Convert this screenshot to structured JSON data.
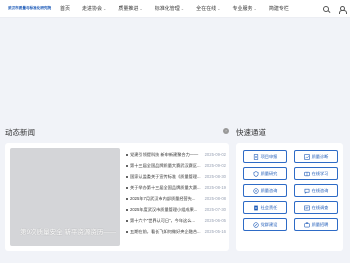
{
  "header": {
    "logo_text": "武汉市质量与标准化研究院",
    "nav": [
      {
        "label": "首页",
        "has_dropdown": false
      },
      {
        "label": "走进协会",
        "has_dropdown": true
      },
      {
        "label": "质量推进",
        "has_dropdown": true
      },
      {
        "label": "标准化管理",
        "has_dropdown": true
      },
      {
        "label": "全在在线",
        "has_dropdown": true
      },
      {
        "label": "专业服务",
        "has_dropdown": true
      },
      {
        "label": "简建专栏",
        "has_dropdown": false
      }
    ],
    "icons": [
      "search-icon",
      "user-icon"
    ]
  },
  "news": {
    "title": "动态新闻",
    "featured_caption": "第9次质量安全 新平资源资历——",
    "items": [
      {
        "title": "党建引领提科技 新申新建聚合力——",
        "date": "2025-09-02"
      },
      {
        "title": "第十三届全国品牌质量大赛武汉赛区...",
        "date": "2025-09-02"
      },
      {
        "title": "国家认监委关于宣传标准《质量管理...",
        "date": "2025-08-30"
      },
      {
        "title": "关于举办第十三届全国品牌质量大赛...",
        "date": "2025-08-19"
      },
      {
        "title": "2025年7月武汉市内部质量经营先...",
        "date": "2025-08-08"
      },
      {
        "title": "2025年度武汉市质量管理小组成果...",
        "date": "2025-07-30"
      },
      {
        "title": "第十六个“世界认可日”，今年这么...",
        "date": "2025-06-05"
      },
      {
        "title": "五期在前，看长飞如何做好央企融合...",
        "date": "2025-05-16"
      }
    ]
  },
  "quick": {
    "title": "快速通道",
    "buttons": [
      {
        "label": "项目申报",
        "icon": "document-icon"
      },
      {
        "label": "质量诊断",
        "icon": "chart-icon"
      },
      {
        "label": "质量研究",
        "icon": "shield-icon"
      },
      {
        "label": "在线学习",
        "icon": "book-icon"
      },
      {
        "label": "质量咨询",
        "icon": "consult-icon"
      },
      {
        "label": "在线咨询",
        "icon": "chat-icon"
      },
      {
        "label": "社会责任",
        "icon": "report-icon"
      },
      {
        "label": "在线调查",
        "icon": "survey-icon"
      },
      {
        "label": "党群建设",
        "icon": "party-icon"
      },
      {
        "label": "质量招聘",
        "icon": "recruit-icon"
      }
    ]
  },
  "colors": {
    "accent": "#1e5bb8",
    "page_bg": "#f1f3f8",
    "date": "#9aa3b5"
  }
}
